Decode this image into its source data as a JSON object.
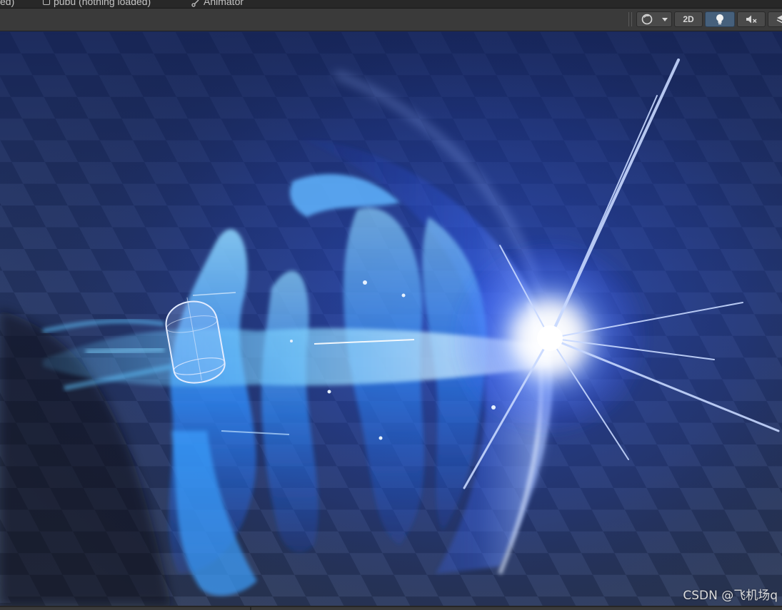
{
  "tabs": [
    {
      "label": "ed)",
      "icon": "none"
    },
    {
      "label": "pubu (nothing loaded)",
      "icon": "prefab-icon"
    },
    {
      "label": "Animator",
      "icon": "animator-icon"
    }
  ],
  "toolbar": {
    "shading_mode_icon": "shading-sphere-icon",
    "dropdown_icon": "chevron-down-icon",
    "mode_2d_label": "2D",
    "lighting_icon": "lightbulb-icon",
    "lighting_active": true,
    "audio_icon": "audio-muted-icon",
    "effects_icon": "layers-icon"
  },
  "colors": {
    "toolbar_bg": "#3a3a3a",
    "active_toggle": "#46607c",
    "effect_core": "#ffffff",
    "effect_glow": "#3d7bff",
    "flame": "#37a8ff"
  },
  "scene": {
    "objects": [
      "capsule-gizmo",
      "blue-fire-wave-effect",
      "starburst-flash",
      "checker-floor"
    ]
  },
  "watermark": "CSDN @飞机场q"
}
